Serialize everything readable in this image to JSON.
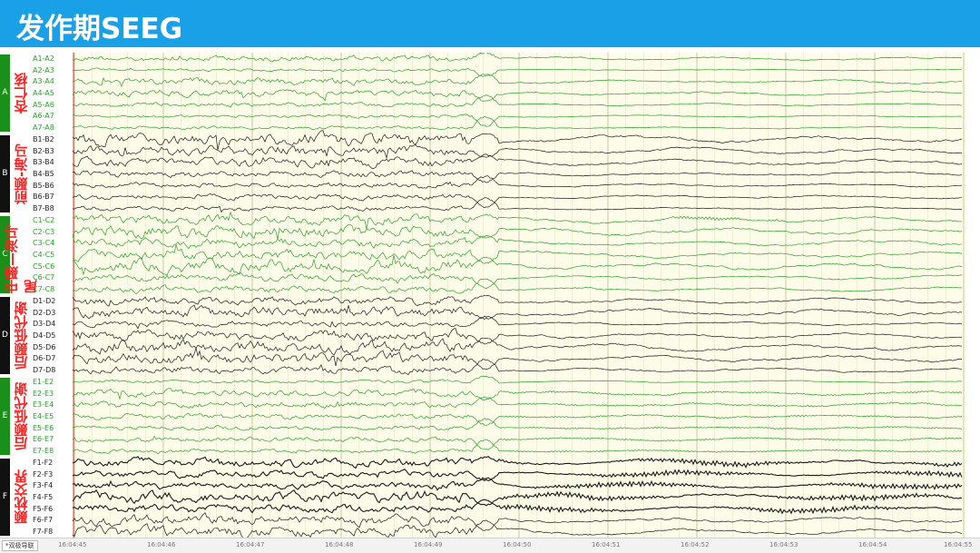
{
  "title": "发作期SEEG",
  "montage": "*双极导联",
  "colors": {
    "title_bg": "#1aa0e6",
    "green_group": "#1a8f1a",
    "black_group": "#111111",
    "green_trace": "#2aa02a",
    "black_trace": "#1a1a1a",
    "region_text": "#ff2020",
    "plot_bg": "#fcfce8"
  },
  "groups": [
    {
      "letter": "A",
      "region": "杏仁核",
      "color": "green",
      "channels": [
        "A1-A2",
        "A2-A3",
        "A3-A4",
        "A4-A5",
        "A5-A6",
        "A6-A7",
        "A7-A8"
      ]
    },
    {
      "letter": "B",
      "region": "前颞-海马",
      "color": "black",
      "channels": [
        "B1-B2",
        "B2-B3",
        "B3-B4",
        "B4-B5",
        "B5-B6",
        "B6-B7",
        "B7-B8"
      ]
    },
    {
      "letter": "C",
      "region": "中颞—海马尾",
      "color": "green",
      "channels": [
        "C1-C2",
        "C2-C3",
        "C3-C4",
        "C4-C5",
        "C5-C6",
        "C6-C7",
        "C7-C8"
      ]
    },
    {
      "letter": "D",
      "region": "后颞低代谢",
      "color": "black",
      "channels": [
        "D1-D2",
        "D2-D3",
        "D3-D4",
        "D4-D5",
        "D5-D6",
        "D6-D7",
        "D7-D8"
      ]
    },
    {
      "letter": "E",
      "region": "后颞低代谢",
      "color": "green",
      "channels": [
        "E1-E2",
        "E2-E3",
        "E3-E4",
        "E4-E5",
        "E5-E6",
        "E6-E7",
        "E7-E8"
      ]
    },
    {
      "letter": "F",
      "region": "颞枕交界",
      "color": "black",
      "channels": [
        "F1-F2",
        "F2-F3",
        "F3-F4",
        "F4-F5",
        "F5-F6",
        "F6-F7",
        "F7-F8"
      ]
    }
  ],
  "time_ticks": [
    "16:04:45",
    "16:04:46",
    "16:04:47",
    "16:04:48",
    "16:04:49",
    "16:04:50",
    "16:04:51",
    "16:04:52",
    "16:04:53",
    "16:04:54",
    "16:04:55"
  ],
  "seizure_onset_time": "16:04:50"
}
